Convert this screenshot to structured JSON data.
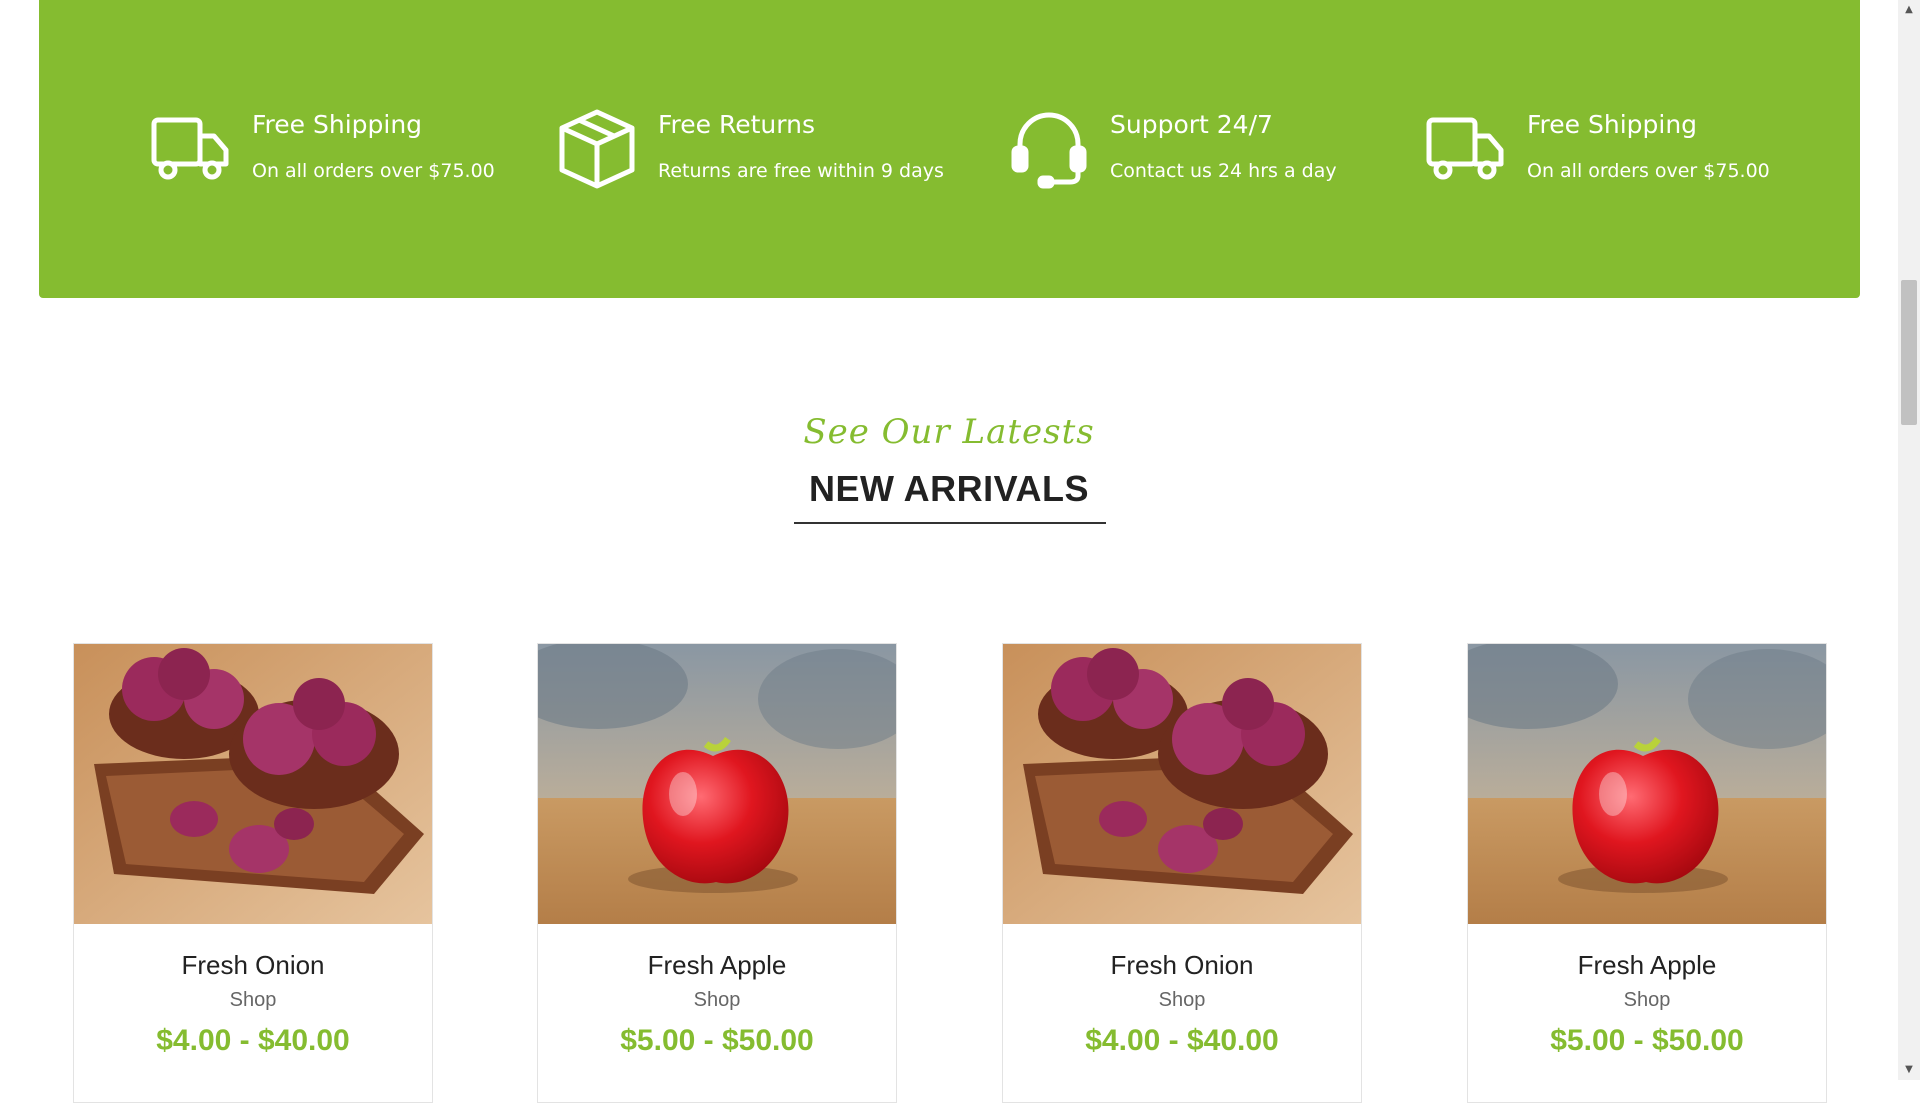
{
  "features": [
    {
      "icon": "truck-icon",
      "title": "Free Shipping",
      "subtitle": "On all orders over $75.00"
    },
    {
      "icon": "box-icon",
      "title": "Free Returns",
      "subtitle": "Returns are free within 9 days"
    },
    {
      "icon": "headset-icon",
      "title": "Support 24/7",
      "subtitle": "Contact us 24 hrs a day"
    },
    {
      "icon": "truck-icon",
      "title": "Free Shipping",
      "subtitle": "On all orders over $75.00"
    }
  ],
  "section": {
    "script_heading": "See Our Latests",
    "title": "NEW ARRIVALS"
  },
  "products": [
    {
      "name": "Fresh Onion",
      "category": "Shop",
      "price": "$4.00 - $40.00",
      "image": "onion-photo"
    },
    {
      "name": "Fresh Apple",
      "category": "Shop",
      "price": "$5.00 - $50.00",
      "image": "apple-photo"
    },
    {
      "name": "Fresh Onion",
      "category": "Shop",
      "price": "$4.00 - $40.00",
      "image": "onion-photo"
    },
    {
      "name": "Fresh Apple",
      "category": "Shop",
      "price": "$5.00 - $50.00",
      "image": "apple-photo"
    }
  ],
  "colors": {
    "accent": "#85bc30",
    "heading": "#222222"
  }
}
